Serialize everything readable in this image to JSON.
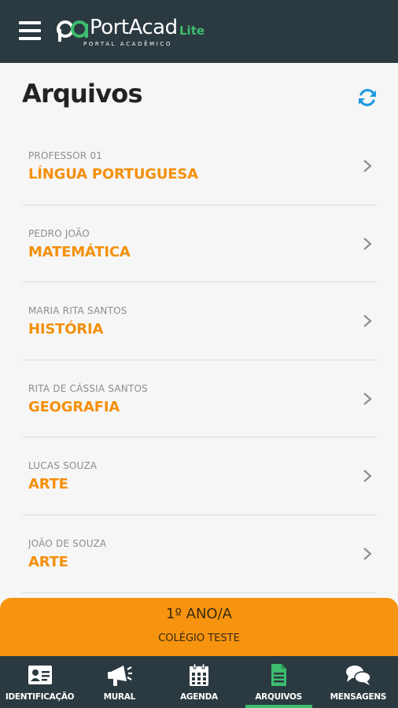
{
  "app": {
    "logo_main": "PortAcad",
    "logo_lite": "Lite",
    "logo_sub": "PORTAL ACADÊMICO"
  },
  "page": {
    "title": "Arquivos"
  },
  "files": [
    {
      "teacher": "PROFESSOR 01",
      "subject": "LÍNGUA PORTUGUESA"
    },
    {
      "teacher": "PEDRO JOÃO",
      "subject": "MATEMÁTICA"
    },
    {
      "teacher": "MARIA RITA SANTOS",
      "subject": "HISTÓRIA"
    },
    {
      "teacher": "RITA DE CÁSSIA SANTOS",
      "subject": "GEOGRAFIA"
    },
    {
      "teacher": "LUCAS SOUZA",
      "subject": "ARTE"
    },
    {
      "teacher": "JOÃO DE SOUZA",
      "subject": "ARTE"
    }
  ],
  "banner": {
    "class_name": "1º ANO/A",
    "school": "COLÉGIO TESTE"
  },
  "nav": [
    {
      "label": "IDENTIFICAÇÃO",
      "icon": "id-card-icon",
      "active": false
    },
    {
      "label": "MURAL",
      "icon": "megaphone-icon",
      "active": false
    },
    {
      "label": "AGENDA",
      "icon": "calendar-icon",
      "active": false
    },
    {
      "label": "ARQUIVOS",
      "icon": "document-icon",
      "active": true
    },
    {
      "label": "MENSAGENS",
      "icon": "chat-bubbles-icon",
      "active": false
    }
  ],
  "colors": {
    "topbar": "#2b3a40",
    "accent_orange": "#f4900c",
    "accent_green": "#3dbd6e",
    "refresh_blue": "#1e9be0"
  }
}
